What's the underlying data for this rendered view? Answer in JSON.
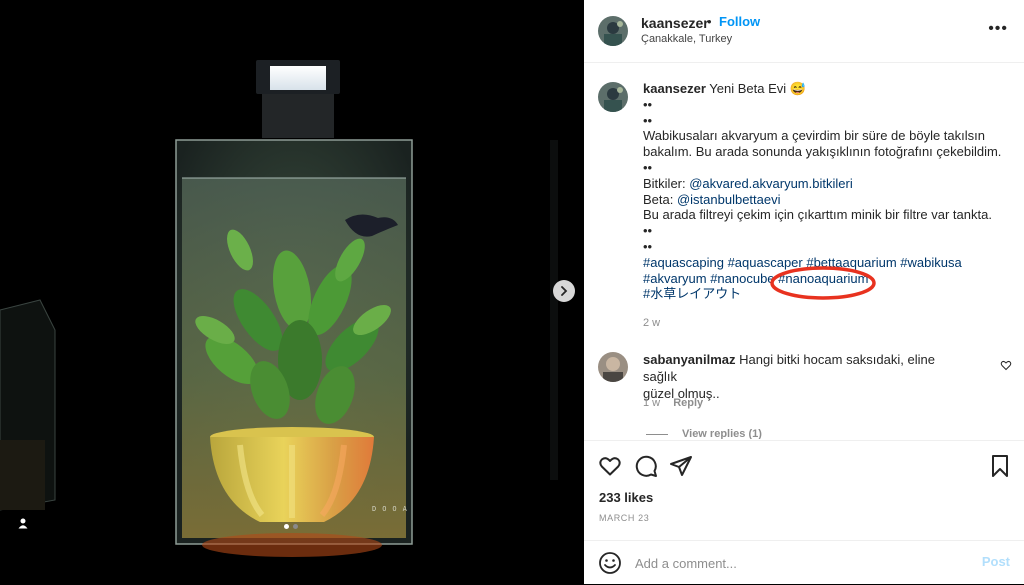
{
  "post": {
    "username": "kaansezer",
    "separator": "•",
    "follow_label": "Follow",
    "location": "Çanakkale, Turkey",
    "more_label": "•••"
  },
  "media": {
    "watermark": "DOOA",
    "carousel_count": 2,
    "carousel_active": 0
  },
  "caption": {
    "username": "kaansezer",
    "title": "Yeni Beta Evi 😅",
    "lines": [
      {
        "text": "••"
      },
      {
        "text": "••"
      },
      {
        "text": "Wabikusaları akvaryum a çevirdim bir süre de böyle takılsın"
      },
      {
        "text": "bakalım. Bu arada sonunda yakışıklının fotoğrafını çekebildim."
      },
      {
        "text": "••"
      },
      {
        "prefix": "Bitkiler: ",
        "link": "@akvared.akvaryum.bitkileri"
      },
      {
        "prefix": "Beta: ",
        "link": "@istanbulbettaevi"
      },
      {
        "text": "Bu arada filtreyi çekim için çıkarttım minik bir filtre var tankta."
      },
      {
        "text": "••"
      },
      {
        "text": "••"
      },
      {
        "link": "#aquascaping #aquascaper #bettaaquarium #wabikusa"
      },
      {
        "link": "#akvaryum #nanocube #nanoaquarium"
      },
      {
        "link": "#水草レイアウト"
      }
    ],
    "time": "2 w"
  },
  "comment": {
    "username": "sabanyanilmaz",
    "text": "Hangi bitki hocam saksıdaki, eline sağlık",
    "text2": "güzel olmuş..",
    "time": "1 w",
    "reply_label": "Reply",
    "view_replies": "View replies (1)"
  },
  "stats": {
    "likes": "233 likes",
    "date": "MARCH 23"
  },
  "composer": {
    "placeholder": "Add a comment...",
    "post_label": "Post"
  },
  "colors": {
    "accent": "#0095f6",
    "link": "#00376b",
    "highlight_circle": "#e8321f",
    "post_disabled": "#b2dffc"
  }
}
